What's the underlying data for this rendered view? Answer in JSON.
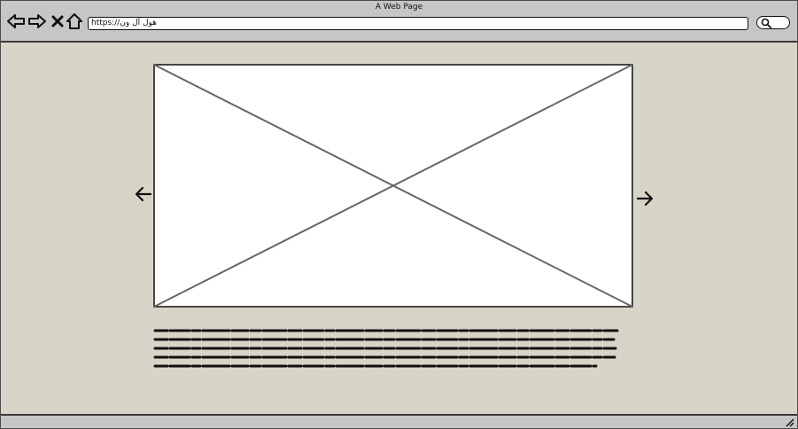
{
  "browser": {
    "title": "A Web Page",
    "url": "https://هول آل ون",
    "nav": {
      "back": "back-arrow",
      "forward": "forward-arrow",
      "stop": "close-x",
      "home": "house"
    },
    "search_icon": "magnifier"
  },
  "carousel": {
    "image": "placeholder-image",
    "prev_icon": "arrow-left",
    "next_icon": "arrow-right"
  },
  "body_text": "scribbled placeholder text (not legible)"
}
